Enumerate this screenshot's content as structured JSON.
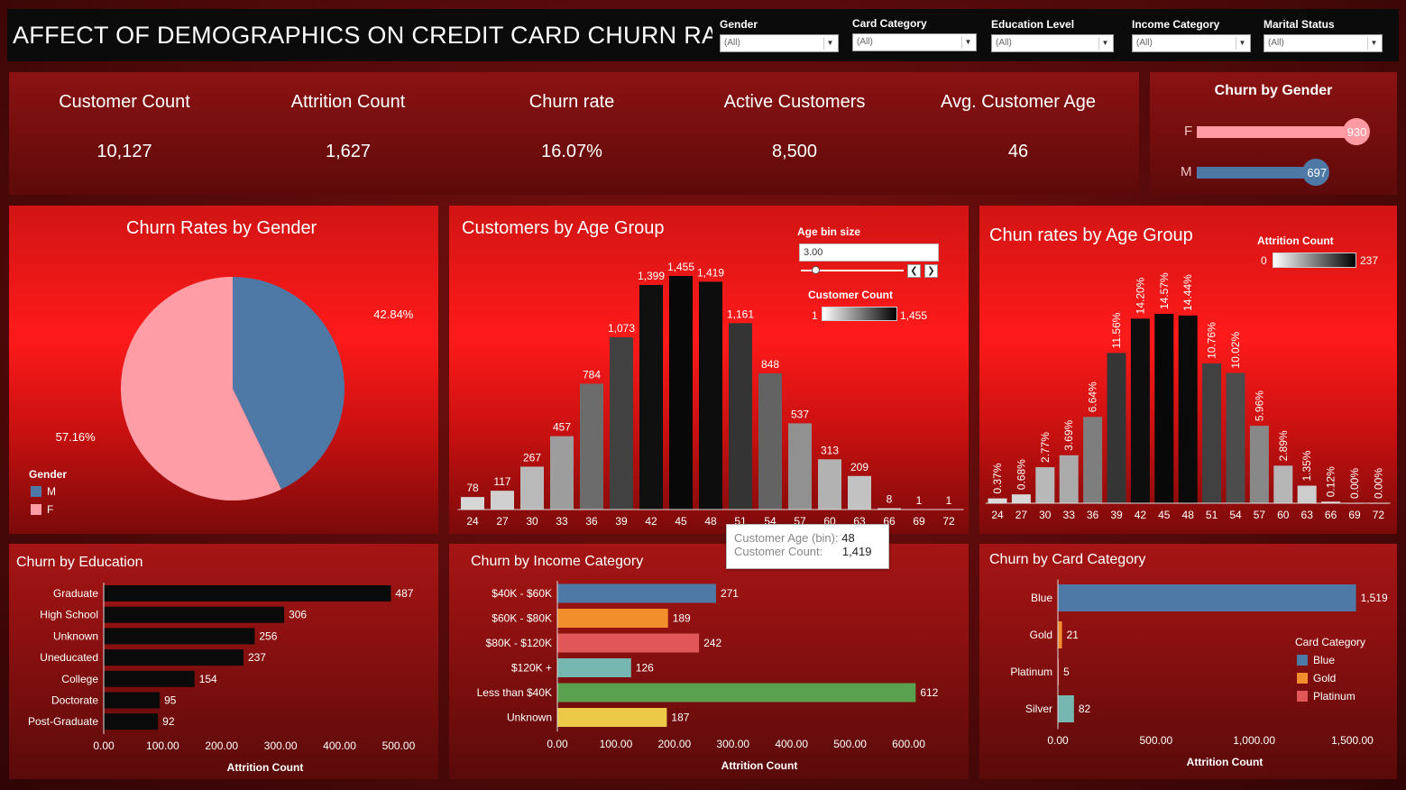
{
  "header": {
    "title": "AFFECT OF DEMOGRAPHICS ON CREDIT CARD  CHURN RATES"
  },
  "filters": [
    {
      "label": "Gender",
      "value": "(All)"
    },
    {
      "label": "Card Category",
      "value": "(All)"
    },
    {
      "label": "Education Level",
      "value": "(All)"
    },
    {
      "label": "Income Category",
      "value": "(All)"
    },
    {
      "label": "Marital Status",
      "value": "(All)"
    }
  ],
  "kpis": [
    {
      "label": "Customer Count",
      "value": "10,127"
    },
    {
      "label": "Attrition Count",
      "value": "1,627"
    },
    {
      "label": "Churn rate",
      "value": "16.07%"
    },
    {
      "label": "Active Customers",
      "value": "8,500"
    },
    {
      "label": "Avg. Customer Age",
      "value": "46"
    }
  ],
  "churn_by_gender_summary": {
    "title": "Churn  by Gender",
    "rows": [
      {
        "label": "F",
        "value": 930,
        "value_label": "930",
        "color": "#ff9aa2"
      },
      {
        "label": "M",
        "value": 697,
        "value_label": "697",
        "color": "#4e79a7"
      }
    ]
  },
  "colors": {
    "male": "#4e79a7",
    "female": "#ff9da7",
    "blue": "#4e79a7",
    "orange": "#f28e2b",
    "red": "#e15759",
    "teal": "#76b7b2",
    "green": "#59a14f",
    "yellow": "#edc948"
  },
  "pie": {
    "title": "Churn Rates by Gender",
    "legend_title": "Gender",
    "legend": [
      {
        "label": "M",
        "color": "#4e79a7"
      },
      {
        "label": "F",
        "color": "#ff9da7"
      }
    ]
  },
  "age_controls": {
    "bin_label": "Age bin size",
    "bin_value": "3.00",
    "customer_count_label": "Customer Count",
    "customer_count_min": "1",
    "customer_count_max": "1,455",
    "attrition_label": "Attrition Count",
    "attrition_min": "0",
    "attrition_max": "237"
  },
  "tooltip": {
    "row1_label": "Customer Age (bin):",
    "row1_value": "48",
    "row2_label": "Customer Count:",
    "row2_value": "1,419"
  },
  "chart_data": [
    {
      "type": "pie",
      "title": "Churn Rates by Gender",
      "series": [
        {
          "name": "M",
          "value": 42.84,
          "label": "42.84%",
          "color": "#4e79a7"
        },
        {
          "name": "F",
          "value": 57.16,
          "label": "57.16%",
          "color": "#ff9da7"
        }
      ],
      "legend": "bottom-left"
    },
    {
      "type": "bar",
      "title": "Customers by Age Group",
      "categories": [
        "24",
        "27",
        "30",
        "33",
        "36",
        "39",
        "42",
        "45",
        "48",
        "51",
        "54",
        "57",
        "60",
        "63",
        "66",
        "69",
        "72"
      ],
      "values": [
        78,
        117,
        267,
        457,
        784,
        1073,
        1399,
        1455,
        1419,
        1161,
        848,
        537,
        313,
        209,
        8,
        1,
        1
      ],
      "labels": [
        "78",
        "117",
        "267",
        "457",
        "784",
        "1,073",
        "1,399",
        "1,455",
        "1,419",
        "1,161",
        "848",
        "537",
        "313",
        "209",
        "8",
        "1",
        "1"
      ],
      "color_scale": [
        1,
        1455
      ]
    },
    {
      "type": "bar",
      "title": "Chun rates by Age Group",
      "categories": [
        "24",
        "27",
        "30",
        "33",
        "36",
        "39",
        "42",
        "45",
        "48",
        "51",
        "54",
        "57",
        "60",
        "63",
        "66",
        "69",
        "72"
      ],
      "values": [
        0.37,
        0.68,
        2.77,
        3.69,
        6.64,
        11.56,
        14.2,
        14.57,
        14.44,
        10.76,
        10.02,
        5.96,
        2.89,
        1.35,
        0.12,
        0.0,
        0.0
      ],
      "labels": [
        "0.37%",
        "0.68%",
        "2.77%",
        "3.69%",
        "6.64%",
        "11.56%",
        "14.20%",
        "14.57%",
        "14.44%",
        "10.76%",
        "10.02%",
        "5.96%",
        "2.89%",
        "1.35%",
        "0.12%",
        "0.00%",
        "0.00%"
      ],
      "color_scale": [
        0,
        237
      ]
    },
    {
      "type": "bar",
      "orientation": "horizontal",
      "title": "Churn by Education",
      "categories": [
        "Graduate",
        "High School",
        "Unknown",
        "Uneducated",
        "College",
        "Doctorate",
        "Post-Graduate"
      ],
      "values": [
        487,
        306,
        256,
        237,
        154,
        95,
        92
      ],
      "xlabel": "Attrition Count",
      "xticks": [
        "0.00",
        "100.00",
        "200.00",
        "300.00",
        "400.00",
        "500.00"
      ],
      "xlim": [
        0,
        520
      ]
    },
    {
      "type": "bar",
      "orientation": "horizontal",
      "title": "Churn by Income Category",
      "categories": [
        "$40K - $60K",
        "$60K - $80K",
        "$80K - $120K",
        "$120K +",
        "Less than $40K",
        "Unknown"
      ],
      "values": [
        271,
        189,
        242,
        126,
        612,
        187
      ],
      "colors": [
        "#4e79a7",
        "#f28e2b",
        "#e15759",
        "#76b7b2",
        "#59a14f",
        "#edc948"
      ],
      "xlabel": "Attrition Count",
      "xticks": [
        "0.00",
        "100.00",
        "200.00",
        "300.00",
        "400.00",
        "500.00",
        "600.00"
      ],
      "xlim": [
        0,
        650
      ]
    },
    {
      "type": "bar",
      "orientation": "horizontal",
      "title": "Churn by Card Category",
      "categories": [
        "Blue",
        "Gold",
        "Platinum",
        "Silver"
      ],
      "values": [
        1519,
        21,
        5,
        82
      ],
      "labels": [
        "1,519",
        "21",
        "5",
        "82"
      ],
      "colors": [
        "#4e79a7",
        "#f28e2b",
        "#e15759",
        "#76b7b2"
      ],
      "xlabel": "Attrition Count",
      "xticks": [
        "0.00",
        "500.00",
        "1,000.00",
        "1,500.00"
      ],
      "xlim": [
        0,
        1700
      ],
      "legend_title": "Card Category",
      "legend": [
        {
          "label": "Blue",
          "color": "#4e79a7"
        },
        {
          "label": "Gold",
          "color": "#f28e2b"
        },
        {
          "label": "Platinum",
          "color": "#e15759"
        }
      ]
    }
  ]
}
